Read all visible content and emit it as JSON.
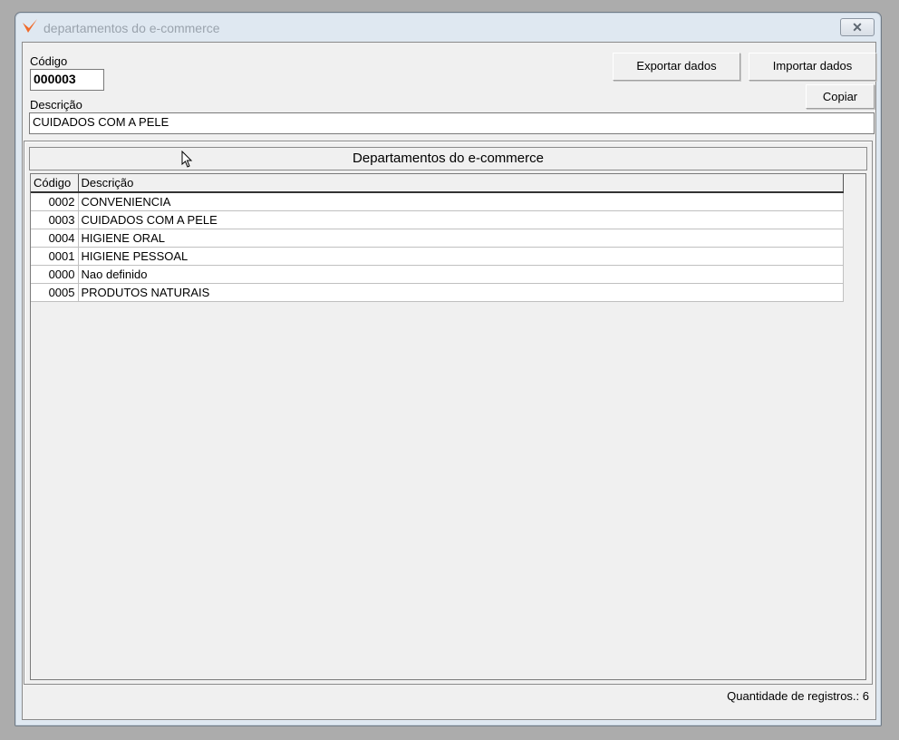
{
  "window": {
    "title": "departamentos do e-commerce",
    "close_icon": "close-icon"
  },
  "form": {
    "codigo_label": "Código",
    "codigo_value": "000003",
    "descricao_label": "Descrição",
    "descricao_value": "CUIDADOS COM A PELE"
  },
  "buttons": {
    "exportar": "Exportar dados",
    "importar": "Importar dados",
    "copiar": "Copiar"
  },
  "panel": {
    "title": "Departamentos do e-commerce"
  },
  "table": {
    "columns": [
      "Código",
      "Descrição"
    ],
    "rows": [
      {
        "codigo": "0002",
        "descricao": "CONVENIENCIA"
      },
      {
        "codigo": "0003",
        "descricao": "CUIDADOS COM A PELE"
      },
      {
        "codigo": "0004",
        "descricao": "HIGIENE ORAL"
      },
      {
        "codigo": "0001",
        "descricao": "HIGIENE PESSOAL"
      },
      {
        "codigo": "0000",
        "descricao": "Nao definido"
      },
      {
        "codigo": "0005",
        "descricao": "PRODUTOS NATURAIS"
      }
    ]
  },
  "status": {
    "record_count": "Quantidade de registros.: 6"
  },
  "colors": {
    "logo": "#f06a2a",
    "client_bg": "#f0f0f0",
    "desktop": "#acacac"
  }
}
